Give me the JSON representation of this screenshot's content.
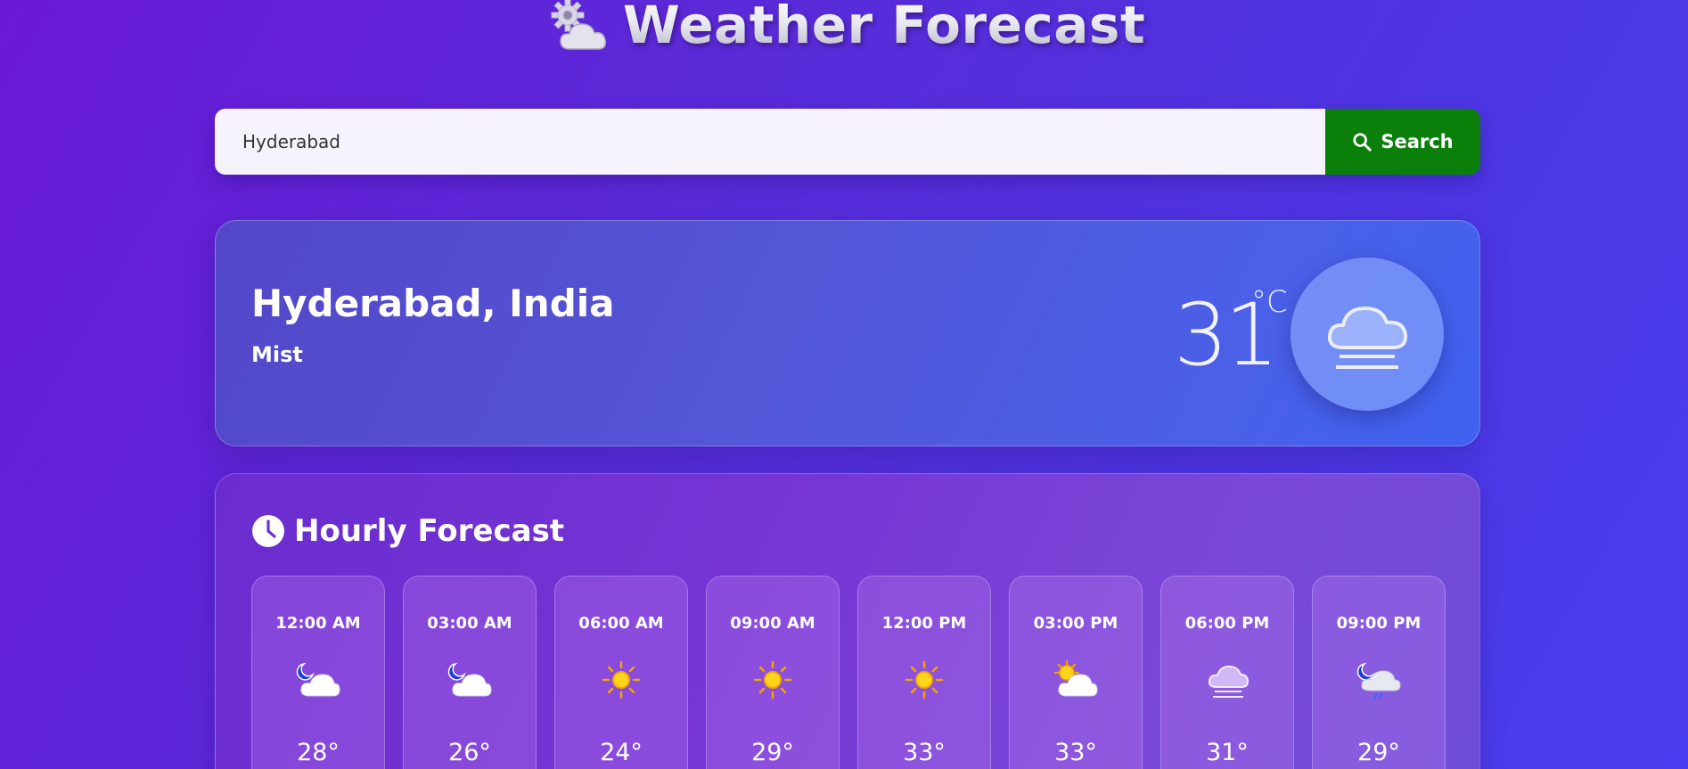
{
  "header": {
    "title": "Weather Forecast",
    "logo_icon": "sun-behind-cloud-icon"
  },
  "search": {
    "value": "Hyderabad",
    "button_label": "Search",
    "button_icon": "search-icon",
    "button_color": "#0a800a"
  },
  "current": {
    "location": "Hyderabad, India",
    "condition": "Mist",
    "temperature": "31",
    "unit": "°C",
    "icon": "mist-cloud-icon"
  },
  "hourly": {
    "title": "Hourly Forecast",
    "title_icon": "clock-icon",
    "items": [
      {
        "time": "12:00 AM",
        "icon": "moon-cloud-icon",
        "temp": "28°"
      },
      {
        "time": "03:00 AM",
        "icon": "moon-cloud-icon",
        "temp": "26°"
      },
      {
        "time": "06:00 AM",
        "icon": "sun-icon",
        "temp": "24°"
      },
      {
        "time": "09:00 AM",
        "icon": "sun-icon",
        "temp": "29°"
      },
      {
        "time": "12:00 PM",
        "icon": "sun-icon",
        "temp": "33°"
      },
      {
        "time": "03:00 PM",
        "icon": "sun-cloud-icon",
        "temp": "33°"
      },
      {
        "time": "06:00 PM",
        "icon": "mist-cloud-icon",
        "temp": "31°"
      },
      {
        "time": "09:00 PM",
        "icon": "moon-rain-icon",
        "temp": "29°"
      }
    ]
  }
}
